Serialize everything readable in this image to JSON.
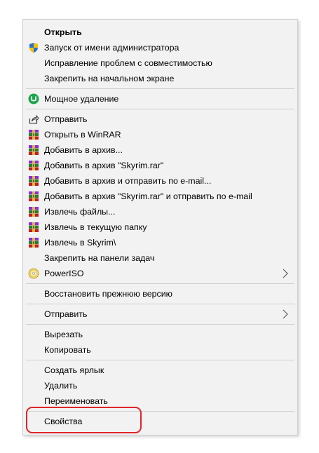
{
  "menu": {
    "items": [
      {
        "label": "Открыть",
        "icon": "none",
        "bold": true
      },
      {
        "label": "Запуск от имени администратора",
        "icon": "uac-shield-icon"
      },
      {
        "label": "Исправление проблем с совместимостью",
        "icon": "none"
      },
      {
        "label": "Закрепить на начальном экране",
        "icon": "none"
      },
      {
        "label": "Мощное удаление",
        "icon": "uninstaller-icon"
      },
      {
        "label": "Отправить",
        "icon": "share-icon"
      },
      {
        "label": "Открыть в WinRAR",
        "icon": "winrar-icon"
      },
      {
        "label": "Добавить в архив...",
        "icon": "winrar-icon"
      },
      {
        "label": "Добавить в архив \"Skyrim.rar\"",
        "icon": "winrar-icon"
      },
      {
        "label": "Добавить в архив и отправить по e-mail...",
        "icon": "winrar-icon"
      },
      {
        "label": "Добавить в архив \"Skyrim.rar\" и отправить по e-mail",
        "icon": "winrar-icon"
      },
      {
        "label": "Извлечь файлы...",
        "icon": "winrar-icon"
      },
      {
        "label": "Извлечь в текущую папку",
        "icon": "winrar-icon"
      },
      {
        "label": "Извлечь в Skyrim\\",
        "icon": "winrar-icon"
      },
      {
        "label": "Закрепить на панели задач",
        "icon": "none"
      },
      {
        "label": "PowerISO",
        "icon": "poweriso-disc-icon",
        "submenu": true
      },
      {
        "label": "Восстановить прежнюю версию",
        "icon": "none"
      },
      {
        "label": "Отправить",
        "icon": "none",
        "submenu": true
      },
      {
        "label": "Вырезать",
        "icon": "none"
      },
      {
        "label": "Копировать",
        "icon": "none"
      },
      {
        "label": "Создать ярлык",
        "icon": "none"
      },
      {
        "label": "Удалить",
        "icon": "none"
      },
      {
        "label": "Переименовать",
        "icon": "none"
      },
      {
        "label": "Свойства",
        "icon": "none",
        "highlighted": true
      }
    ]
  },
  "colors": {
    "menu_background": "#f2f2f2",
    "separator": "#cfcfcf",
    "highlight_border": "#e0242b",
    "uninstaller_green": "#1aa64a"
  }
}
